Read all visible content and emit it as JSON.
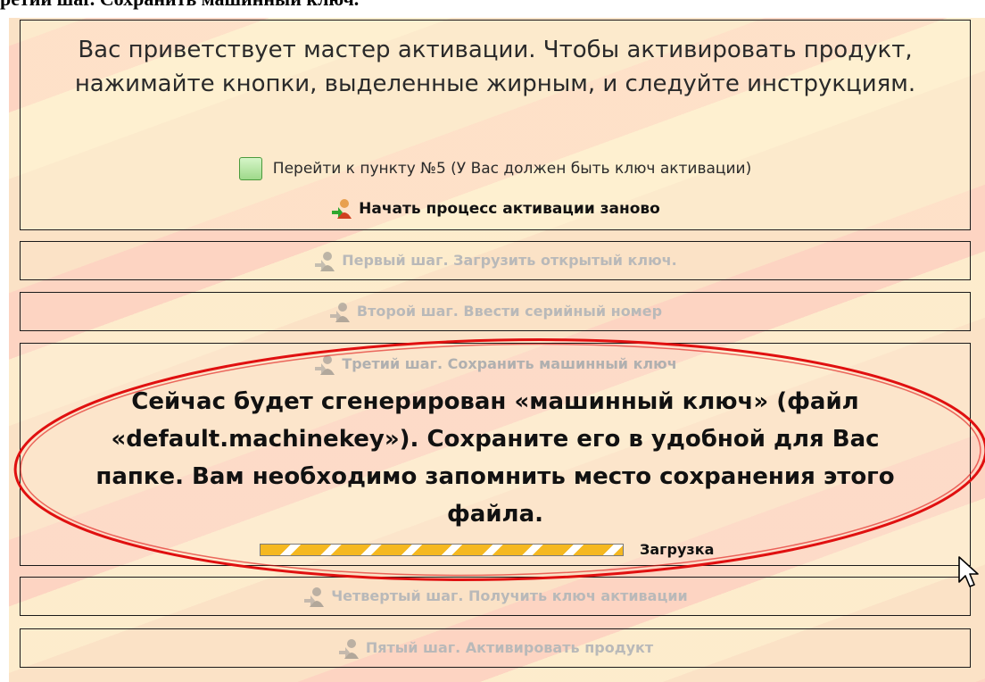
{
  "header": {
    "caption": "ретий шаг. Сохранить машинный ключ."
  },
  "welcome": {
    "text": "Вас приветствует мастер активации. Чтобы активировать продукт, нажимайте кнопки, выделенные жирным, и следуйте инструкциям.",
    "skip_label": "Перейти к пункту №5 (У Вас должен быть ключ активации)",
    "restart_label": "Начать процесс активации заново"
  },
  "steps": [
    {
      "label": "Первый шаг. Загрузить открытый ключ.",
      "state": "disabled"
    },
    {
      "label": "Второй шаг. Ввести серийный номер",
      "state": "disabled"
    },
    {
      "label": "Третий шаг. Сохранить машинный ключ",
      "state": "active",
      "message": "Сейчас будет сгенерирован «машинный ключ» (файл «default.machinekey»). Сохраните его в удобной для Вас папке. Вам необходимо запомнить место сохранения этого файла.",
      "progress_label": "Загрузка"
    },
    {
      "label": "Четвертый шаг. Получить ключ активации",
      "state": "disabled"
    },
    {
      "label": "Пятый шаг. Активировать продукт",
      "state": "disabled"
    }
  ],
  "colors": {
    "panel_bg": "#fbe2c6",
    "disabled_text": "#b9b9b9",
    "highlight_ellipse": "#e01010",
    "progress_stripe": "#f5b820"
  },
  "icons": {
    "step": "user-arrow-icon",
    "skip": "checkbox-icon",
    "cursor": "mouse-cursor-icon"
  }
}
